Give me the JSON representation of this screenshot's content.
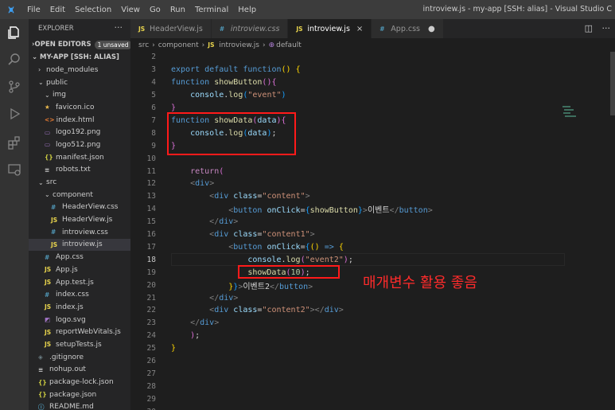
{
  "titlebar": {
    "menu": [
      "File",
      "Edit",
      "Selection",
      "View",
      "Go",
      "Run",
      "Terminal",
      "Help"
    ],
    "title": "introview.js - my-app [SSH: alias] - Visual Studio C"
  },
  "activity_icons": [
    "files-icon",
    "search-icon",
    "source-control-icon",
    "run-debug-icon",
    "extensions-icon",
    "remote-explorer-icon"
  ],
  "sidebar": {
    "title": "EXPLORER",
    "more": "···",
    "open_editors": "OPEN EDITORS",
    "unsaved_badge": "1 unsaved",
    "root": "MY-APP [SSH: ALIAS]",
    "tree": [
      {
        "label": "node_modules",
        "icon": "",
        "depth": 0,
        "chev": "›",
        "kind": "folder"
      },
      {
        "label": "public",
        "icon": "",
        "depth": 0,
        "chev": "⌄",
        "kind": "folder"
      },
      {
        "label": "img",
        "icon": "",
        "depth": 1,
        "chev": "⌄",
        "kind": "folder"
      },
      {
        "label": "favicon.ico",
        "icon": "★",
        "depth": 1,
        "chev": "",
        "kind": "star"
      },
      {
        "label": "index.html",
        "icon": "<>",
        "depth": 1,
        "chev": "",
        "kind": "html"
      },
      {
        "label": "logo192.png",
        "icon": "▭",
        "depth": 1,
        "chev": "",
        "kind": "img"
      },
      {
        "label": "logo512.png",
        "icon": "▭",
        "depth": 1,
        "chev": "",
        "kind": "img"
      },
      {
        "label": "manifest.json",
        "icon": "{}",
        "depth": 1,
        "chev": "",
        "kind": "json"
      },
      {
        "label": "robots.txt",
        "icon": "≡",
        "depth": 1,
        "chev": "",
        "kind": "txt"
      },
      {
        "label": "src",
        "icon": "",
        "depth": 0,
        "chev": "⌄",
        "kind": "folder"
      },
      {
        "label": "component",
        "icon": "",
        "depth": 1,
        "chev": "⌄",
        "kind": "folder"
      },
      {
        "label": "HeaderView.css",
        "icon": "#",
        "depth": 2,
        "chev": "",
        "kind": "css"
      },
      {
        "label": "HeaderView.js",
        "icon": "JS",
        "depth": 2,
        "chev": "",
        "kind": "js"
      },
      {
        "label": "introview.css",
        "icon": "#",
        "depth": 2,
        "chev": "",
        "kind": "css"
      },
      {
        "label": "introview.js",
        "icon": "JS",
        "depth": 2,
        "chev": "",
        "kind": "js",
        "active": true
      },
      {
        "label": "App.css",
        "icon": "#",
        "depth": 1,
        "chev": "",
        "kind": "css"
      },
      {
        "label": "App.js",
        "icon": "JS",
        "depth": 1,
        "chev": "",
        "kind": "js"
      },
      {
        "label": "App.test.js",
        "icon": "JS",
        "depth": 1,
        "chev": "",
        "kind": "js"
      },
      {
        "label": "index.css",
        "icon": "#",
        "depth": 1,
        "chev": "",
        "kind": "css"
      },
      {
        "label": "index.js",
        "icon": "JS",
        "depth": 1,
        "chev": "",
        "kind": "js"
      },
      {
        "label": "logo.svg",
        "icon": "◩",
        "depth": 1,
        "chev": "",
        "kind": "img"
      },
      {
        "label": "reportWebVitals.js",
        "icon": "JS",
        "depth": 1,
        "chev": "",
        "kind": "js"
      },
      {
        "label": "setupTests.js",
        "icon": "JS",
        "depth": 1,
        "chev": "",
        "kind": "js"
      },
      {
        "label": ".gitignore",
        "icon": "◈",
        "depth": 0,
        "chev": "",
        "kind": "git"
      },
      {
        "label": "nohup.out",
        "icon": "≡",
        "depth": 0,
        "chev": "",
        "kind": "txt"
      },
      {
        "label": "package-lock.json",
        "icon": "{}",
        "depth": 0,
        "chev": "",
        "kind": "json"
      },
      {
        "label": "package.json",
        "icon": "{}",
        "depth": 0,
        "chev": "",
        "kind": "json"
      },
      {
        "label": "README.md",
        "icon": "ⓘ",
        "depth": 0,
        "chev": "",
        "kind": "md"
      }
    ]
  },
  "tabs": [
    {
      "label": "HeaderView.js",
      "icon": "JS",
      "kind": "js",
      "active": false,
      "italic": false,
      "trailing": ""
    },
    {
      "label": "introview.css",
      "icon": "#",
      "kind": "css",
      "active": false,
      "italic": true,
      "trailing": ""
    },
    {
      "label": "introview.js",
      "icon": "JS",
      "kind": "js",
      "active": true,
      "italic": false,
      "trailing": "×"
    },
    {
      "label": "App.css",
      "icon": "#",
      "kind": "css",
      "active": false,
      "italic": false,
      "trailing": "●"
    }
  ],
  "tab_actions": [
    "split-editor-icon",
    "more-actions-icon"
  ],
  "breadcrumb": [
    "src",
    "component",
    "introview.js",
    "default"
  ],
  "breadcrumb_icons": {
    "file": "JS",
    "symbol": "⊕"
  },
  "editor": {
    "current_line": 18,
    "lines": [
      {
        "n": 2,
        "tokens": []
      },
      {
        "n": 3,
        "tokens": [
          [
            "kw",
            "export"
          ],
          [
            "plain",
            " "
          ],
          [
            "kw",
            "default"
          ],
          [
            "plain",
            " "
          ],
          [
            "kw",
            "function"
          ],
          [
            "brk1",
            "()"
          ],
          [
            "plain",
            " "
          ],
          [
            "brk1",
            "{"
          ]
        ]
      },
      {
        "n": 4,
        "tokens": [
          [
            "kw",
            "function"
          ],
          [
            "plain",
            " "
          ],
          [
            "fn",
            "showButton"
          ],
          [
            "brk2",
            "()"
          ],
          [
            "brk2",
            "{"
          ]
        ]
      },
      {
        "n": 5,
        "tokens": [
          [
            "plain",
            "    "
          ],
          [
            "var",
            "console"
          ],
          [
            "plain",
            "."
          ],
          [
            "fn",
            "log"
          ],
          [
            "brk3",
            "("
          ],
          [
            "str",
            "\"event\""
          ],
          [
            "brk3",
            ")"
          ]
        ]
      },
      {
        "n": 6,
        "tokens": [
          [
            "brk2",
            "}"
          ]
        ]
      },
      {
        "n": 7,
        "tokens": [
          [
            "kw",
            "function"
          ],
          [
            "plain",
            " "
          ],
          [
            "fn",
            "showData"
          ],
          [
            "brk2",
            "("
          ],
          [
            "var",
            "data"
          ],
          [
            "brk2",
            ")"
          ],
          [
            "brk2",
            "{"
          ]
        ]
      },
      {
        "n": 8,
        "tokens": [
          [
            "plain",
            "    "
          ],
          [
            "var",
            "console"
          ],
          [
            "plain",
            "."
          ],
          [
            "fn",
            "log"
          ],
          [
            "brk3",
            "("
          ],
          [
            "var",
            "data"
          ],
          [
            "brk3",
            ")"
          ],
          [
            "plain",
            ";"
          ]
        ]
      },
      {
        "n": 9,
        "tokens": [
          [
            "brk2",
            "}"
          ]
        ]
      },
      {
        "n": 10,
        "tokens": []
      },
      {
        "n": 11,
        "tokens": [
          [
            "plain",
            "    "
          ],
          [
            "kw2",
            "return"
          ],
          [
            "brk2",
            "("
          ]
        ]
      },
      {
        "n": 12,
        "tokens": [
          [
            "plain",
            "    "
          ],
          [
            "tagb",
            "<"
          ],
          [
            "tag",
            "div"
          ],
          [
            "tagb",
            ">"
          ]
        ]
      },
      {
        "n": 13,
        "tokens": [
          [
            "plain",
            "        "
          ],
          [
            "tagb",
            "<"
          ],
          [
            "tag",
            "div"
          ],
          [
            "plain",
            " "
          ],
          [
            "attr",
            "class"
          ],
          [
            "plain",
            "="
          ],
          [
            "str",
            "\"content\""
          ],
          [
            "tagb",
            ">"
          ]
        ]
      },
      {
        "n": 14,
        "tokens": [
          [
            "plain",
            "            "
          ],
          [
            "tagb",
            "<"
          ],
          [
            "tag",
            "button"
          ],
          [
            "plain",
            " "
          ],
          [
            "attr",
            "onClick"
          ],
          [
            "plain",
            "="
          ],
          [
            "brk3",
            "{"
          ],
          [
            "fn",
            "showButton"
          ],
          [
            "brk3",
            "}"
          ],
          [
            "tagb",
            ">"
          ],
          [
            "plain",
            "이벤트"
          ],
          [
            "tagb",
            "</"
          ],
          [
            "tag",
            "button"
          ],
          [
            "tagb",
            ">"
          ]
        ]
      },
      {
        "n": 15,
        "tokens": [
          [
            "plain",
            "        "
          ],
          [
            "tagb",
            "</"
          ],
          [
            "tag",
            "div"
          ],
          [
            "tagb",
            ">"
          ]
        ]
      },
      {
        "n": 16,
        "tokens": [
          [
            "plain",
            "        "
          ],
          [
            "tagb",
            "<"
          ],
          [
            "tag",
            "div"
          ],
          [
            "plain",
            " "
          ],
          [
            "attr",
            "class"
          ],
          [
            "plain",
            "="
          ],
          [
            "str",
            "\"content1\""
          ],
          [
            "tagb",
            ">"
          ]
        ]
      },
      {
        "n": 17,
        "tokens": [
          [
            "plain",
            "            "
          ],
          [
            "tagb",
            "<"
          ],
          [
            "tag",
            "button"
          ],
          [
            "plain",
            " "
          ],
          [
            "attr",
            "onClick"
          ],
          [
            "plain",
            "="
          ],
          [
            "brk3",
            "{"
          ],
          [
            "brk1",
            "()"
          ],
          [
            "plain",
            " "
          ],
          [
            "kw",
            "=>"
          ],
          [
            "plain",
            " "
          ],
          [
            "brk1",
            "{"
          ]
        ]
      },
      {
        "n": 18,
        "tokens": [
          [
            "plain",
            "                "
          ],
          [
            "var",
            "console"
          ],
          [
            "plain",
            "."
          ],
          [
            "fn",
            "log"
          ],
          [
            "brk2",
            "("
          ],
          [
            "str",
            "\"event2\""
          ],
          [
            "brk2",
            ")"
          ],
          [
            "plain",
            ";"
          ]
        ]
      },
      {
        "n": 19,
        "tokens": [
          [
            "plain",
            "                "
          ],
          [
            "fn",
            "showData"
          ],
          [
            "brk2",
            "("
          ],
          [
            "num",
            "10"
          ],
          [
            "brk2",
            ")"
          ],
          [
            "plain",
            ";"
          ]
        ]
      },
      {
        "n": 20,
        "tokens": [
          [
            "plain",
            "            "
          ],
          [
            "brk1",
            "}"
          ],
          [
            "brk3",
            "}"
          ],
          [
            "tagb",
            ">"
          ],
          [
            "plain",
            "이벤트2"
          ],
          [
            "tagb",
            "</"
          ],
          [
            "tag",
            "button"
          ],
          [
            "tagb",
            ">"
          ]
        ]
      },
      {
        "n": 21,
        "tokens": [
          [
            "plain",
            "        "
          ],
          [
            "tagb",
            "</"
          ],
          [
            "tag",
            "div"
          ],
          [
            "tagb",
            ">"
          ]
        ]
      },
      {
        "n": 22,
        "tokens": [
          [
            "plain",
            "        "
          ],
          [
            "tagb",
            "<"
          ],
          [
            "tag",
            "div"
          ],
          [
            "plain",
            " "
          ],
          [
            "attr",
            "class"
          ],
          [
            "plain",
            "="
          ],
          [
            "str",
            "\"content2\""
          ],
          [
            "tagb",
            "></"
          ],
          [
            "tag",
            "div"
          ],
          [
            "tagb",
            ">"
          ]
        ]
      },
      {
        "n": 23,
        "tokens": [
          [
            "plain",
            "    "
          ],
          [
            "tagb",
            "</"
          ],
          [
            "tag",
            "div"
          ],
          [
            "tagb",
            ">"
          ]
        ]
      },
      {
        "n": 24,
        "tokens": [
          [
            "plain",
            "    "
          ],
          [
            "brk2",
            ")"
          ],
          [
            "plain",
            ";"
          ]
        ]
      },
      {
        "n": 25,
        "tokens": [
          [
            "brk1",
            "}"
          ]
        ]
      },
      {
        "n": 26,
        "tokens": []
      },
      {
        "n": 27,
        "tokens": []
      },
      {
        "n": 28,
        "tokens": []
      },
      {
        "n": 29,
        "tokens": []
      },
      {
        "n": 30,
        "tokens": []
      }
    ]
  },
  "annotation": {
    "text": "매개변수 활용 좋음",
    "color": "#ff2b2b"
  },
  "colors": {
    "accent": "#007acc",
    "keyword": "#569cd6",
    "function": "#dcdcaa",
    "string": "#ce9178",
    "variable": "#9cdcfe",
    "number": "#b5cea8",
    "annotation_box": "#ff1a1a"
  }
}
